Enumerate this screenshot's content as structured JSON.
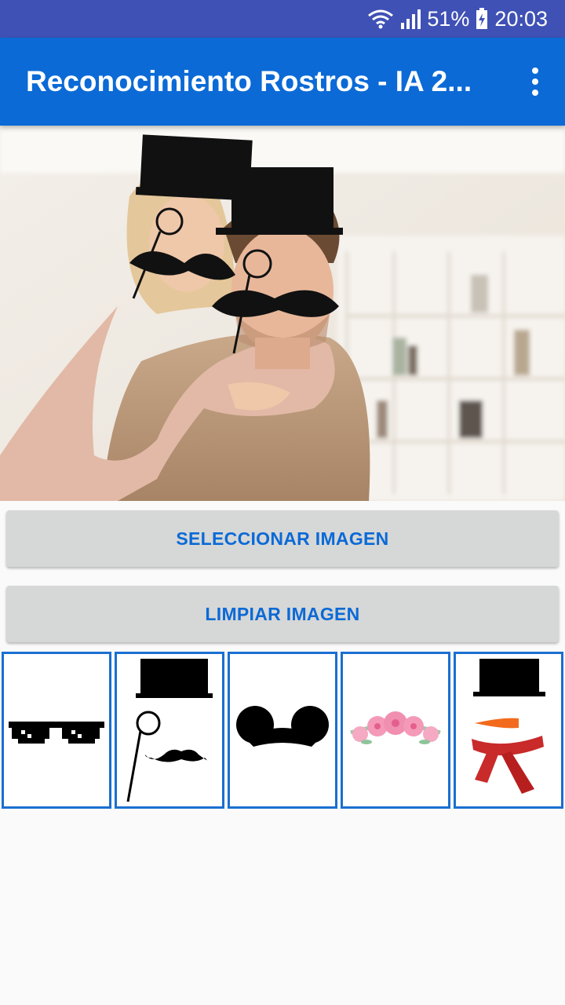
{
  "status_bar": {
    "wifi_icon": "wifi-icon",
    "signal_icon": "signal-icon",
    "battery_percent": "51%",
    "battery_icon": "battery-charging-icon",
    "time": "20:03"
  },
  "toolbar": {
    "title": "Reconocimiento Rostros - IA 2...",
    "menu_icon": "more-vert-icon",
    "background": "#0b6ad6"
  },
  "photo": {
    "description_icon": "couple-photo-with-overlays"
  },
  "buttons": {
    "select_label": "SELECCIONAR IMAGEN",
    "clear_label": "LIMPIAR IMAGEN"
  },
  "filters": [
    {
      "icon": "pixel-sunglasses-icon"
    },
    {
      "icon": "top-hat-monocle-mustache-icon"
    },
    {
      "icon": "mouse-ears-icon"
    },
    {
      "icon": "flower-crown-icon"
    },
    {
      "icon": "snowman-hat-nose-scarf-icon"
    }
  ],
  "colors": {
    "accent": "#0b6ad6",
    "status_bar": "#3f51b5",
    "button_bg": "#d6d7d7",
    "filter_border": "#1a6fd1"
  }
}
